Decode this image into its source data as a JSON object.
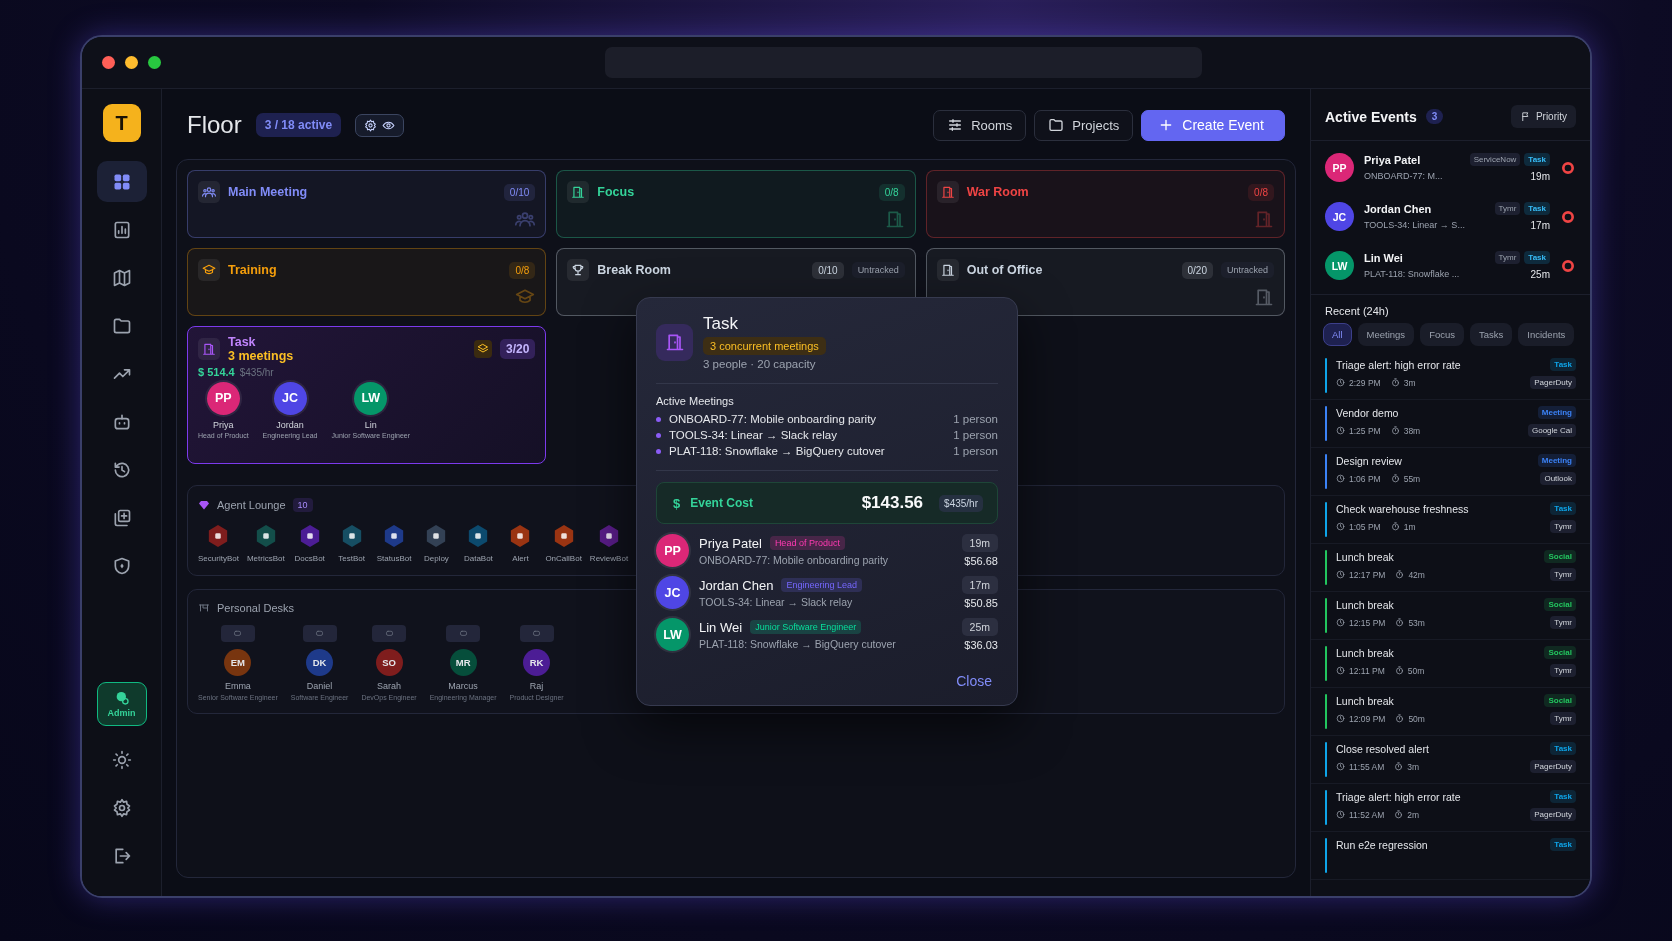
{
  "sidebar": {
    "logo": "T",
    "nav": [
      {
        "selected": true
      },
      {
        "selected": false
      },
      {
        "selected": false
      },
      {
        "selected": false
      },
      {
        "selected": false
      },
      {
        "selected": false
      },
      {
        "selected": false
      },
      {
        "selected": false
      },
      {
        "selected": false
      }
    ],
    "admin": {
      "label": "Admin",
      "active": true
    }
  },
  "header": {
    "title": "Floor",
    "active_badge": "3 / 18 active",
    "buttons": [
      {
        "label": "Rooms",
        "kind": "outline"
      },
      {
        "label": "Projects",
        "kind": "outline"
      },
      {
        "label": "Create Event",
        "kind": "primary"
      }
    ]
  },
  "rooms": [
    {
      "name": "Main Meeting",
      "count": "0/10",
      "color": "#818cf8",
      "kind": "people",
      "corner_icon": true
    },
    {
      "name": "Focus",
      "count": "0/8",
      "color": "#34d399",
      "kind": "door",
      "corner_icon": true
    },
    {
      "name": "War Room",
      "count": "0/8",
      "color": "#ef4444",
      "kind": "door",
      "corner_icon": true
    },
    {
      "name": "Training",
      "count": "0/8",
      "color": "#f59e0b",
      "kind": "cap",
      "corner_icon": true
    },
    {
      "name": "Break Room",
      "count": "0/10",
      "tag": "Untracked",
      "color": "#cbd5e1",
      "kind": "trophy",
      "corner_icon": false
    },
    {
      "name": "Out of Office",
      "count": "0/20",
      "tag": "Untracked",
      "color": "#cbd5e1",
      "kind": "door",
      "corner_icon": true
    }
  ],
  "active_room": {
    "name": "Task",
    "meetings": "3 meetings",
    "cost": "$ 514.4",
    "rate": "$435/hr",
    "count": "3/20",
    "people": [
      {
        "initials": "PP",
        "name": "Priya",
        "role": "Head of Product",
        "color": "#db2777"
      },
      {
        "initials": "JC",
        "name": "Jordan",
        "role": "Engineering Lead",
        "color": "#4f46e5"
      },
      {
        "initials": "LW",
        "name": "Lin",
        "role": "Junior Software Engineer",
        "color": "#059669"
      }
    ]
  },
  "agent_lounge": {
    "title": "Agent Lounge",
    "count": "10",
    "agents": [
      {
        "name": "SecurityBot",
        "color": "#7f1d1d"
      },
      {
        "name": "MetricsBot",
        "color": "#134e4a"
      },
      {
        "name": "DocsBot",
        "color": "#4c1d95"
      },
      {
        "name": "TestBot",
        "color": "#164e63"
      },
      {
        "name": "StatusBot",
        "color": "#1e3a8a"
      },
      {
        "name": "Deploy",
        "color": "#334155"
      },
      {
        "name": "DataBot",
        "color": "#0c4a6e"
      },
      {
        "name": "Alert",
        "color": "#9a3412"
      },
      {
        "name": "OnCallBot",
        "color": "#9a3412"
      },
      {
        "name": "ReviewBot",
        "color": "#581c87"
      }
    ]
  },
  "personal_desks": {
    "title": "Personal Desks",
    "desks": [
      {
        "initials": "EM",
        "name": "Emma",
        "role": "Senior Software Engineer",
        "color": "#78350f"
      },
      {
        "initials": "DK",
        "name": "Daniel",
        "role": "Software Engineer",
        "color": "#1e3a8a"
      },
      {
        "initials": "SO",
        "name": "Sarah",
        "role": "DevOps Engineer",
        "color": "#7f1d1d"
      },
      {
        "initials": "MR",
        "name": "Marcus",
        "role": "Engineering Manager",
        "color": "#064e3b"
      },
      {
        "initials": "RK",
        "name": "Raj",
        "role": "Product Designer",
        "color": "#4c1d95"
      }
    ]
  },
  "modal": {
    "title": "Task",
    "badge": "3 concurrent meetings",
    "subtitle": "3 people · 20 capacity",
    "section": "Active Meetings",
    "meetings": [
      {
        "title": "ONBOARD-77: Mobile onboarding parity",
        "people": "1 person"
      },
      {
        "title": "TOOLS-34: Linear → Slack relay",
        "people": "1 person"
      },
      {
        "title": "PLAT-118: Snowflake → BigQuery cutover",
        "people": "1 person"
      }
    ],
    "cost": {
      "symbol": "$",
      "label": "Event Cost",
      "amount": "$143.56",
      "rate": "$435/hr"
    },
    "attendees": [
      {
        "initials": "PP",
        "name": "Priya Patel",
        "role": "Head of Product",
        "meeting": "ONBOARD-77: Mobile onboarding parity",
        "duration": "19m",
        "cost": "$56.68",
        "color": "#db2777"
      },
      {
        "initials": "JC",
        "name": "Jordan Chen",
        "role": "Engineering Lead",
        "meeting": "TOOLS-34: Linear → Slack relay",
        "duration": "17m",
        "cost": "$50.85",
        "color": "#4f46e5"
      },
      {
        "initials": "LW",
        "name": "Lin Wei",
        "role": "Junior Software Engineer",
        "meeting": "PLAT-118: Snowflake → BigQuery cutover",
        "duration": "25m",
        "cost": "$36.03",
        "color": "#059669"
      }
    ],
    "close": "Close"
  },
  "events_panel": {
    "title": "Active Events",
    "count": "3",
    "priority": "Priority",
    "events": [
      {
        "initials": "PP",
        "name": "Priya Patel",
        "source": "ServiceNow",
        "type": "Task",
        "meeting": "ONBOARD-77: M...",
        "duration": "19m",
        "color": "#db2777"
      },
      {
        "initials": "JC",
        "name": "Jordan Chen",
        "source": "Tymr",
        "type": "Task",
        "meeting": "TOOLS-34: Linear → S...",
        "duration": "17m",
        "color": "#4f46e5"
      },
      {
        "initials": "LW",
        "name": "Lin Wei",
        "source": "Tymr",
        "type": "Task",
        "meeting": "PLAT-118: Snowflake ...",
        "duration": "25m",
        "color": "#059669"
      }
    ],
    "recent_title": "Recent (24h)",
    "filters": [
      {
        "label": "All",
        "selected": true
      },
      {
        "label": "Meetings",
        "selected": false
      },
      {
        "label": "Focus",
        "selected": false
      },
      {
        "label": "Tasks",
        "selected": false
      },
      {
        "label": "Incidents",
        "selected": false
      }
    ],
    "recent": [
      {
        "title": "Triage alert: high error rate",
        "type": "Task",
        "time": "2:29 PM",
        "duration": "3m",
        "source": "PagerDuty",
        "color": "#0ea5e9"
      },
      {
        "title": "Vendor demo",
        "type": "Meeting",
        "time": "1:25 PM",
        "duration": "38m",
        "source": "Google Cal",
        "color": "#3b82f6"
      },
      {
        "title": "Design review",
        "type": "Meeting",
        "time": "1:06 PM",
        "duration": "55m",
        "source": "Outlook",
        "color": "#3b82f6"
      },
      {
        "title": "Check warehouse freshness",
        "type": "Task",
        "time": "1:05 PM",
        "duration": "1m",
        "source": "Tymr",
        "color": "#0ea5e9"
      },
      {
        "title": "Lunch break",
        "type": "Social",
        "time": "12:17 PM",
        "duration": "42m",
        "source": "Tymr",
        "color": "#22c55e"
      },
      {
        "title": "Lunch break",
        "type": "Social",
        "time": "12:15 PM",
        "duration": "53m",
        "source": "Tymr",
        "color": "#22c55e"
      },
      {
        "title": "Lunch break",
        "type": "Social",
        "time": "12:11 PM",
        "duration": "50m",
        "source": "Tymr",
        "color": "#22c55e"
      },
      {
        "title": "Lunch break",
        "type": "Social",
        "time": "12:09 PM",
        "duration": "50m",
        "source": "Tymr",
        "color": "#22c55e"
      },
      {
        "title": "Close resolved alert",
        "type": "Task",
        "time": "11:55 AM",
        "duration": "3m",
        "source": "PagerDuty",
        "color": "#0ea5e9"
      },
      {
        "title": "Triage alert: high error rate",
        "type": "Task",
        "time": "11:52 AM",
        "duration": "2m",
        "source": "PagerDuty",
        "color": "#0ea5e9"
      },
      {
        "title": "Run e2e regression",
        "type": "Task",
        "color": "#0ea5e9"
      }
    ]
  }
}
